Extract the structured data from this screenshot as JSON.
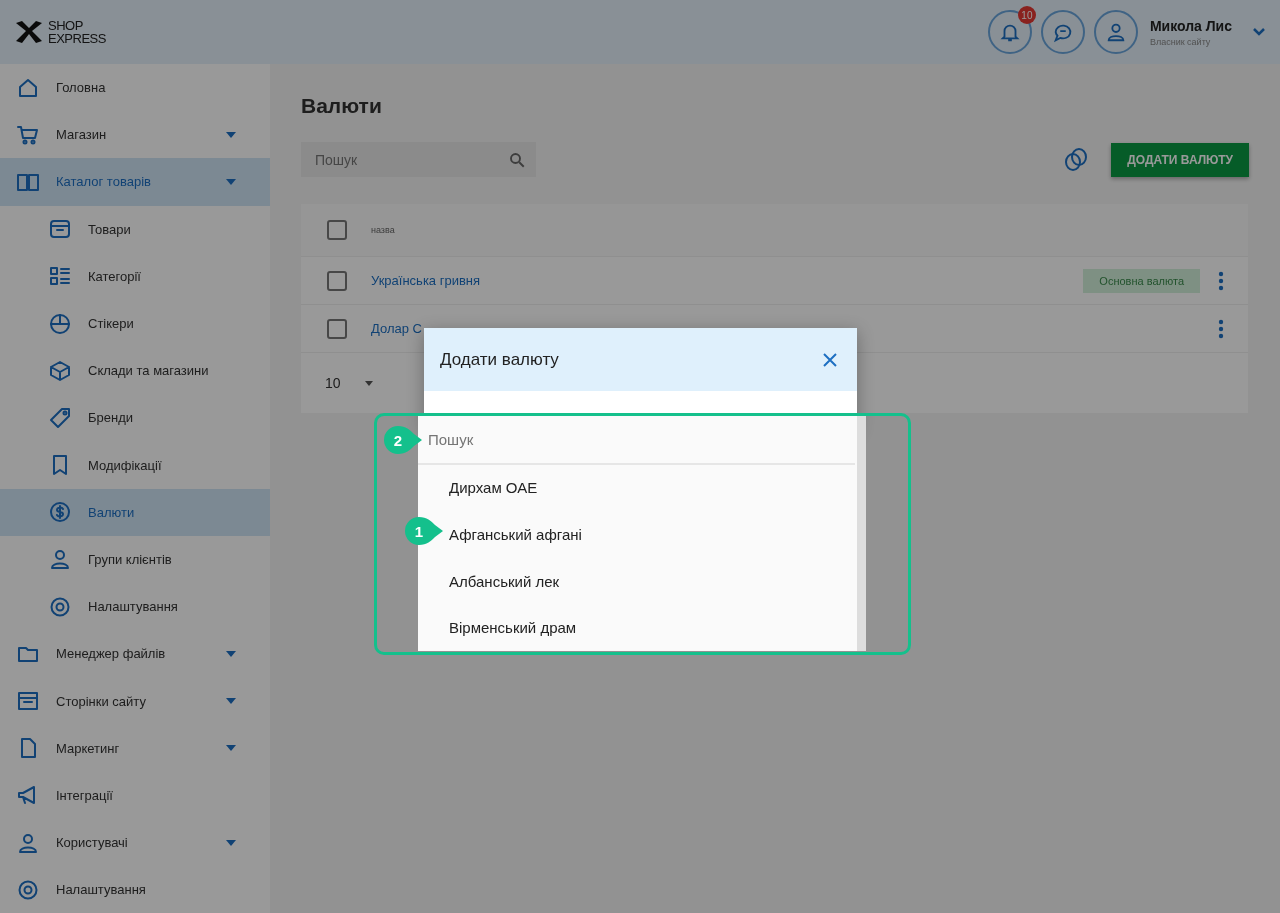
{
  "header": {
    "logo": [
      "SHOP",
      "EXPRESS"
    ],
    "notifications_badge": "10",
    "user": {
      "name": "Микола Лис",
      "role": "Власник сайту"
    }
  },
  "sidebar": {
    "items": [
      {
        "label": "Головна",
        "kind": "link",
        "selected": false
      },
      {
        "label": "Магазин",
        "kind": "group",
        "selected": false
      },
      {
        "label": "Каталог товарів",
        "kind": "group",
        "selected": true,
        "children": [
          {
            "label": "Товари",
            "selected": false
          },
          {
            "label": "Категорії",
            "selected": false
          },
          {
            "label": "Стікери",
            "selected": false
          },
          {
            "label": "Склади та магазини",
            "selected": false
          },
          {
            "label": "Бренди",
            "selected": false
          },
          {
            "label": "Модифікації",
            "selected": false
          },
          {
            "label": "Валюти",
            "selected": true
          },
          {
            "label": "Групи клієнтів",
            "selected": false
          },
          {
            "label": "Налаштування",
            "selected": false
          }
        ]
      },
      {
        "label": "Менеджер файлів",
        "kind": "group",
        "selected": false
      },
      {
        "label": "Сторінки сайту",
        "kind": "group",
        "selected": false
      },
      {
        "label": "Маркетинг",
        "kind": "group",
        "selected": false
      },
      {
        "label": "Інтеграції",
        "kind": "link",
        "selected": false
      },
      {
        "label": "Користувачі",
        "kind": "group",
        "selected": false
      },
      {
        "label": "Налаштування",
        "kind": "link",
        "selected": false
      }
    ]
  },
  "page": {
    "title": "Валюти",
    "search": {
      "placeholder": "Пошук"
    },
    "add_button": "ДОДАТИ ВАЛЮТУ"
  },
  "table": {
    "columns": [
      "назва"
    ],
    "all_checked": false,
    "rows": [
      {
        "name": "Українська гривня",
        "checked": false,
        "badge": "Основна валюта"
      },
      {
        "name": "Долар С",
        "checked": false
      }
    ],
    "page_size": "10"
  },
  "modal": {
    "title": "Додати валюту",
    "dropdown": {
      "search": {
        "placeholder": "Пошук",
        "callout": "2"
      },
      "options": [
        {
          "label": "Дирхам ОАЕ"
        },
        {
          "label": "Афганський афгані",
          "callout": "1"
        },
        {
          "label": "Албанський лек"
        },
        {
          "label": "Вірменський драм"
        }
      ]
    }
  }
}
